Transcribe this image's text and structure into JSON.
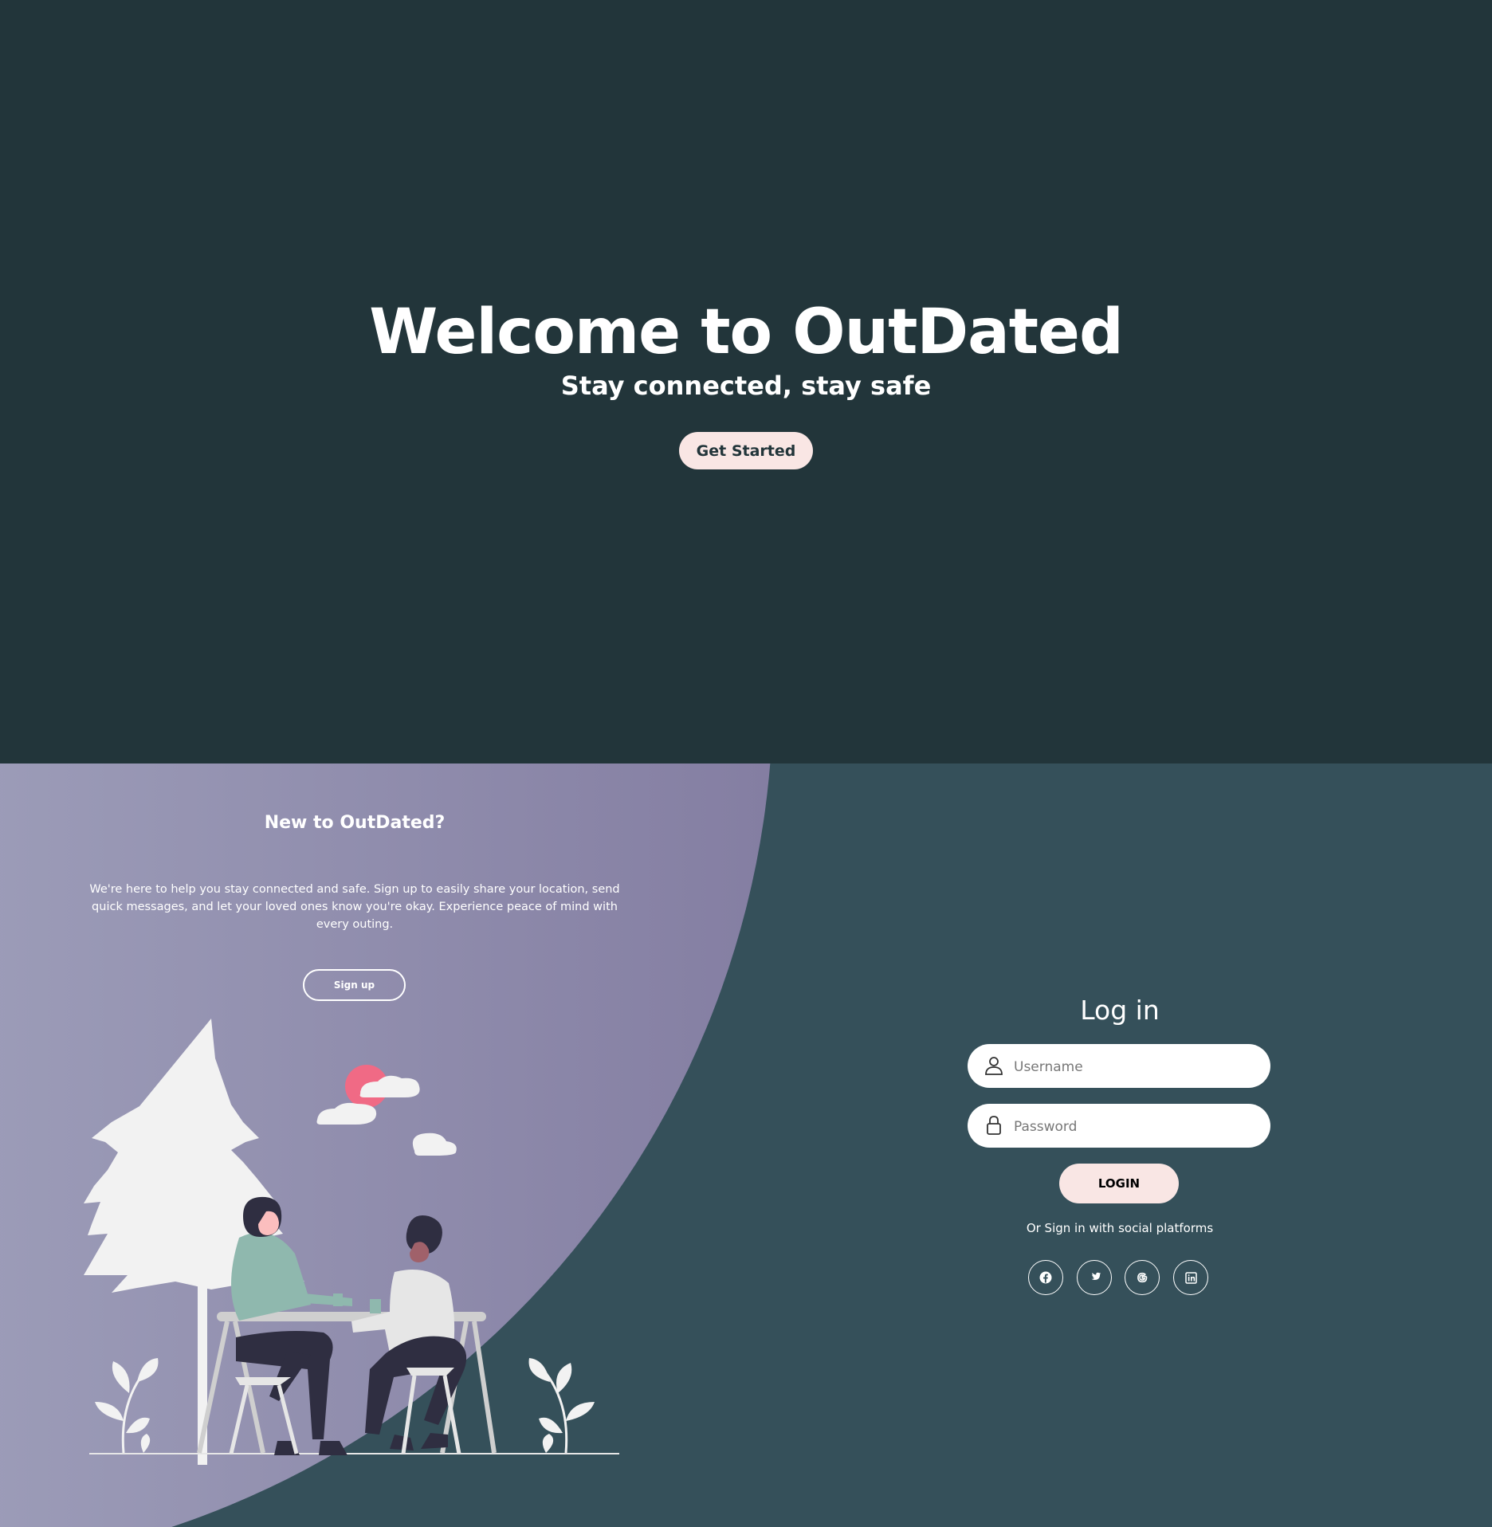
{
  "hero": {
    "title": "Welcome to OutDated",
    "subtitle": "Stay connected, stay safe",
    "cta_label": "Get Started"
  },
  "signup_panel": {
    "title": "New to OutDated?",
    "description": "We're here to help you stay connected and safe. Sign up to easily share your location, send quick messages, and let your loved ones know you're okay. Experience peace of mind with every outing.",
    "signup_label": "Sign up"
  },
  "login": {
    "title": "Log in",
    "username_placeholder": "Username",
    "password_placeholder": "Password",
    "login_label": "LOGIN",
    "social_text": "Or Sign in with social platforms",
    "social_icons": [
      "facebook-icon",
      "twitter-icon",
      "google-icon",
      "linkedin-icon"
    ]
  },
  "colors": {
    "hero_bg": "#22353A",
    "auth_bg": "#35505A",
    "accent_pink": "#F9E6E4",
    "sun": "#F06A85",
    "panel_gradient_start": "#BABECF",
    "panel_gradient_end": "#847EA2"
  }
}
